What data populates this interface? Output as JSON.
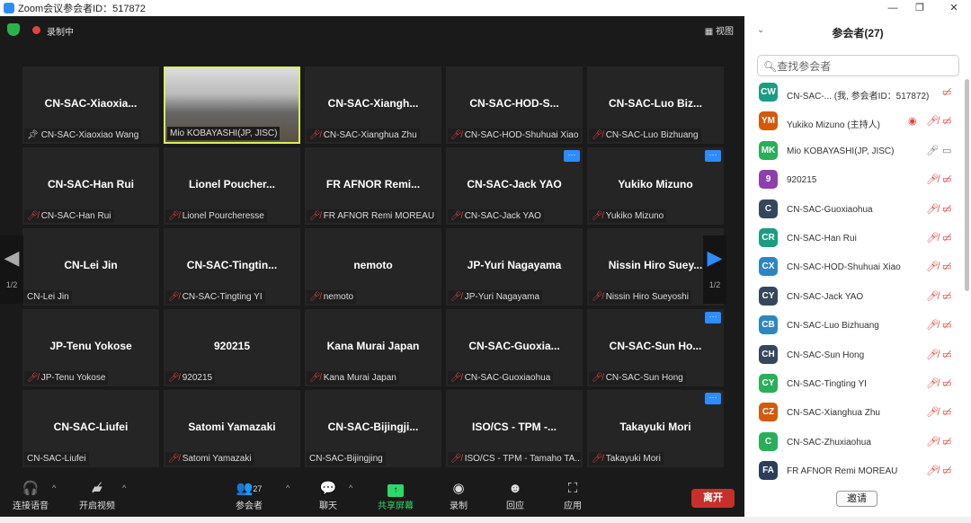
{
  "window": {
    "title": "Zoom会议参会者ID：517872",
    "min": "—",
    "max": "❐",
    "close": "✕"
  },
  "topbar": {
    "recording": "录制中",
    "view": "视图"
  },
  "tiles": [
    {
      "big": "CN-SAC-Xiaoxia...",
      "label": "CN-SAC-Xiaoxiao Wang",
      "icon": "pin"
    },
    {
      "big": "",
      "label": "Mio KOBAYASHI(JP, JISC)",
      "icon": "none",
      "video": true
    },
    {
      "big": "CN-SAC-Xiangh...",
      "label": "CN-SAC-Xianghua Zhu",
      "icon": "muted"
    },
    {
      "big": "CN-SAC-HOD-S...",
      "label": "CN-SAC-HOD-Shuhuai Xiao",
      "icon": "muted"
    },
    {
      "big": "CN-SAC-Luo  Biz...",
      "label": "CN-SAC-Luo Bizhuang",
      "icon": "muted"
    },
    {
      "big": "CN-SAC-Han Rui",
      "label": "CN-SAC-Han Rui",
      "icon": "muted"
    },
    {
      "big": "Lionel  Poucher...",
      "label": "Lionel Pourcheresse",
      "icon": "muted"
    },
    {
      "big": "FR AFNOR Remi...",
      "label": "FR AFNOR Remi MOREAU",
      "icon": "muted"
    },
    {
      "big": "CN-SAC-Jack YAO",
      "label": "CN-SAC-Jack YAO",
      "icon": "muted",
      "more": true
    },
    {
      "big": "Yukiko Mizuno",
      "label": "Yukiko Mizuno",
      "icon": "muted",
      "more": true
    },
    {
      "big": "CN-Lei Jin",
      "label": "CN-Lei Jin",
      "icon": "none"
    },
    {
      "big": "CN-SAC-Tingtin...",
      "label": "CN-SAC-Tingting YI",
      "icon": "muted"
    },
    {
      "big": "nemoto",
      "label": "nemoto",
      "icon": "muted"
    },
    {
      "big": "JP-Yuri Nagayama",
      "label": "JP-Yuri Nagayama",
      "icon": "muted"
    },
    {
      "big": "Nissin  Hiro  Suey...",
      "label": "Nissin Hiro Sueyoshi",
      "icon": "muted"
    },
    {
      "big": "JP-Tenu Yokose",
      "label": "JP-Tenu Yokose",
      "icon": "muted"
    },
    {
      "big": "920215",
      "label": "920215",
      "icon": "muted"
    },
    {
      "big": "Kana Murai Japan",
      "label": "Kana Murai Japan",
      "icon": "muted"
    },
    {
      "big": "CN-SAC-Guoxia...",
      "label": "CN-SAC-Guoxiaohua",
      "icon": "muted"
    },
    {
      "big": "CN-SAC-Sun  Ho...",
      "label": "CN-SAC-Sun Hong",
      "icon": "muted",
      "more": true
    },
    {
      "big": "CN-SAC-Liufei",
      "label": "CN-SAC-Liufei",
      "icon": "none"
    },
    {
      "big": "Satomi Yamazaki",
      "label": "Satomi Yamazaki",
      "icon": "muted"
    },
    {
      "big": "CN-SAC-Bijingji...",
      "label": "CN-SAC-Bijingjing",
      "icon": "none"
    },
    {
      "big": "ISO/CS - TPM -...",
      "label": "ISO/CS - TPM - Tamaho TA...",
      "icon": "muted"
    },
    {
      "big": "Takayuki    Mori",
      "label": "Takayuki    Mori",
      "icon": "muted",
      "more": true
    }
  ],
  "more_label": "···",
  "paging": {
    "page": "1/2"
  },
  "toolbar": {
    "audio": "连接语音",
    "video": "开启视频",
    "participants": "参会者",
    "participants_count": "27",
    "chat": "聊天",
    "share": "共享屏幕",
    "record": "录制",
    "reactions": "回应",
    "apps": "应用",
    "leave": "离开"
  },
  "panel": {
    "title": "参会者(27)",
    "search_placeholder": "查找参会者",
    "invite": "邀请",
    "participants": [
      {
        "initials": "CW",
        "color": "#1c9c80",
        "name": "CN-SAC-... (我, 参会者ID：517872)",
        "rec": false,
        "muted": false,
        "novideo": true
      },
      {
        "initials": "YM",
        "color": "#d35a0c",
        "name": "Yukiko Mizuno (主持人)",
        "rec": true,
        "muted": true,
        "novideo": true
      },
      {
        "initials": "MK",
        "color": "#2aae5a",
        "name": "Mio KOBAYASHI(JP, JISC)",
        "rec": false,
        "muted": false,
        "novideo": false,
        "mic": true
      },
      {
        "initials": "9",
        "color": "#8e3fae",
        "name": "920215",
        "muted": true,
        "novideo": true
      },
      {
        "initials": "C",
        "color": "#34475c",
        "name": "CN-SAC-Guoxiaohua",
        "muted": true,
        "novideo": true
      },
      {
        "initials": "CR",
        "color": "#1c9c80",
        "name": "CN-SAC-Han Rui",
        "muted": true,
        "novideo": true
      },
      {
        "initials": "CX",
        "color": "#2e86c1",
        "name": "CN-SAC-HOD-Shuhuai Xiao",
        "muted": true,
        "novideo": true
      },
      {
        "initials": "CY",
        "color": "#34475c",
        "name": "CN-SAC-Jack YAO",
        "muted": true,
        "novideo": true
      },
      {
        "initials": "CB",
        "color": "#2e86c1",
        "name": "CN-SAC-Luo Bizhuang",
        "muted": true,
        "novideo": true
      },
      {
        "initials": "CH",
        "color": "#34475c",
        "name": "CN-SAC-Sun Hong",
        "muted": true,
        "novideo": true
      },
      {
        "initials": "CY",
        "color": "#2aae5a",
        "name": "CN-SAC-Tingting YI",
        "muted": true,
        "novideo": true
      },
      {
        "initials": "CZ",
        "color": "#d35a0c",
        "name": "CN-SAC-Xianghua Zhu",
        "muted": true,
        "novideo": true
      },
      {
        "initials": "C",
        "color": "#2aae5a",
        "name": "CN-SAC-Zhuxiaohua",
        "muted": true,
        "novideo": true
      },
      {
        "initials": "FA",
        "color": "#2b3e5a",
        "name": "FR AFNOR Remi MOREAU",
        "muted": true,
        "novideo": true
      }
    ]
  }
}
